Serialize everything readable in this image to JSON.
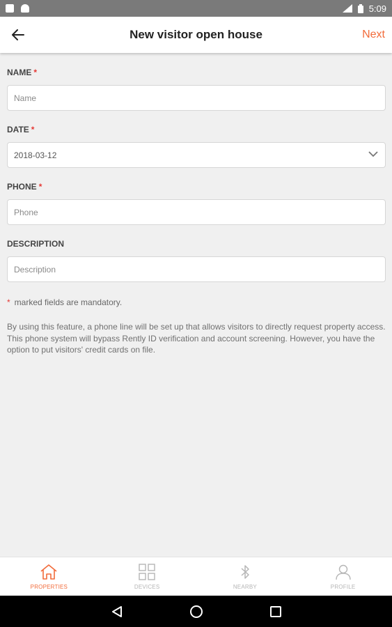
{
  "status_bar": {
    "time": "5:09"
  },
  "app_bar": {
    "title": "New visitor open house",
    "next_label": "Next"
  },
  "form": {
    "name": {
      "label": "NAME",
      "required_mark": "*",
      "placeholder": "Name"
    },
    "date": {
      "label": "DATE",
      "required_mark": "*",
      "value": "2018-03-12"
    },
    "phone": {
      "label": "PHONE",
      "required_mark": "*",
      "placeholder": "Phone"
    },
    "description": {
      "label": "DESCRIPTION",
      "placeholder": "Description"
    }
  },
  "mandatory_note": {
    "star": "*",
    "text": "marked fields are mandatory."
  },
  "disclaimer": "By using this feature, a phone line will be set up that allows visitors to directly request property access. This phone system will bypass Rently ID verification and account screening. However, you have the option to put visitors' credit cards on file.",
  "bottom_nav": {
    "items": [
      {
        "label": "PROPERTIES",
        "icon": "home-icon",
        "active": true
      },
      {
        "label": "DEVICES",
        "icon": "grid-icon",
        "active": false
      },
      {
        "label": "NEARBY",
        "icon": "bluetooth-icon",
        "active": false
      },
      {
        "label": "PROFILE",
        "icon": "person-icon",
        "active": false
      }
    ]
  },
  "colors": {
    "accent": "#f26b3a",
    "required": "#e53935",
    "background": "#f0f0f0"
  }
}
